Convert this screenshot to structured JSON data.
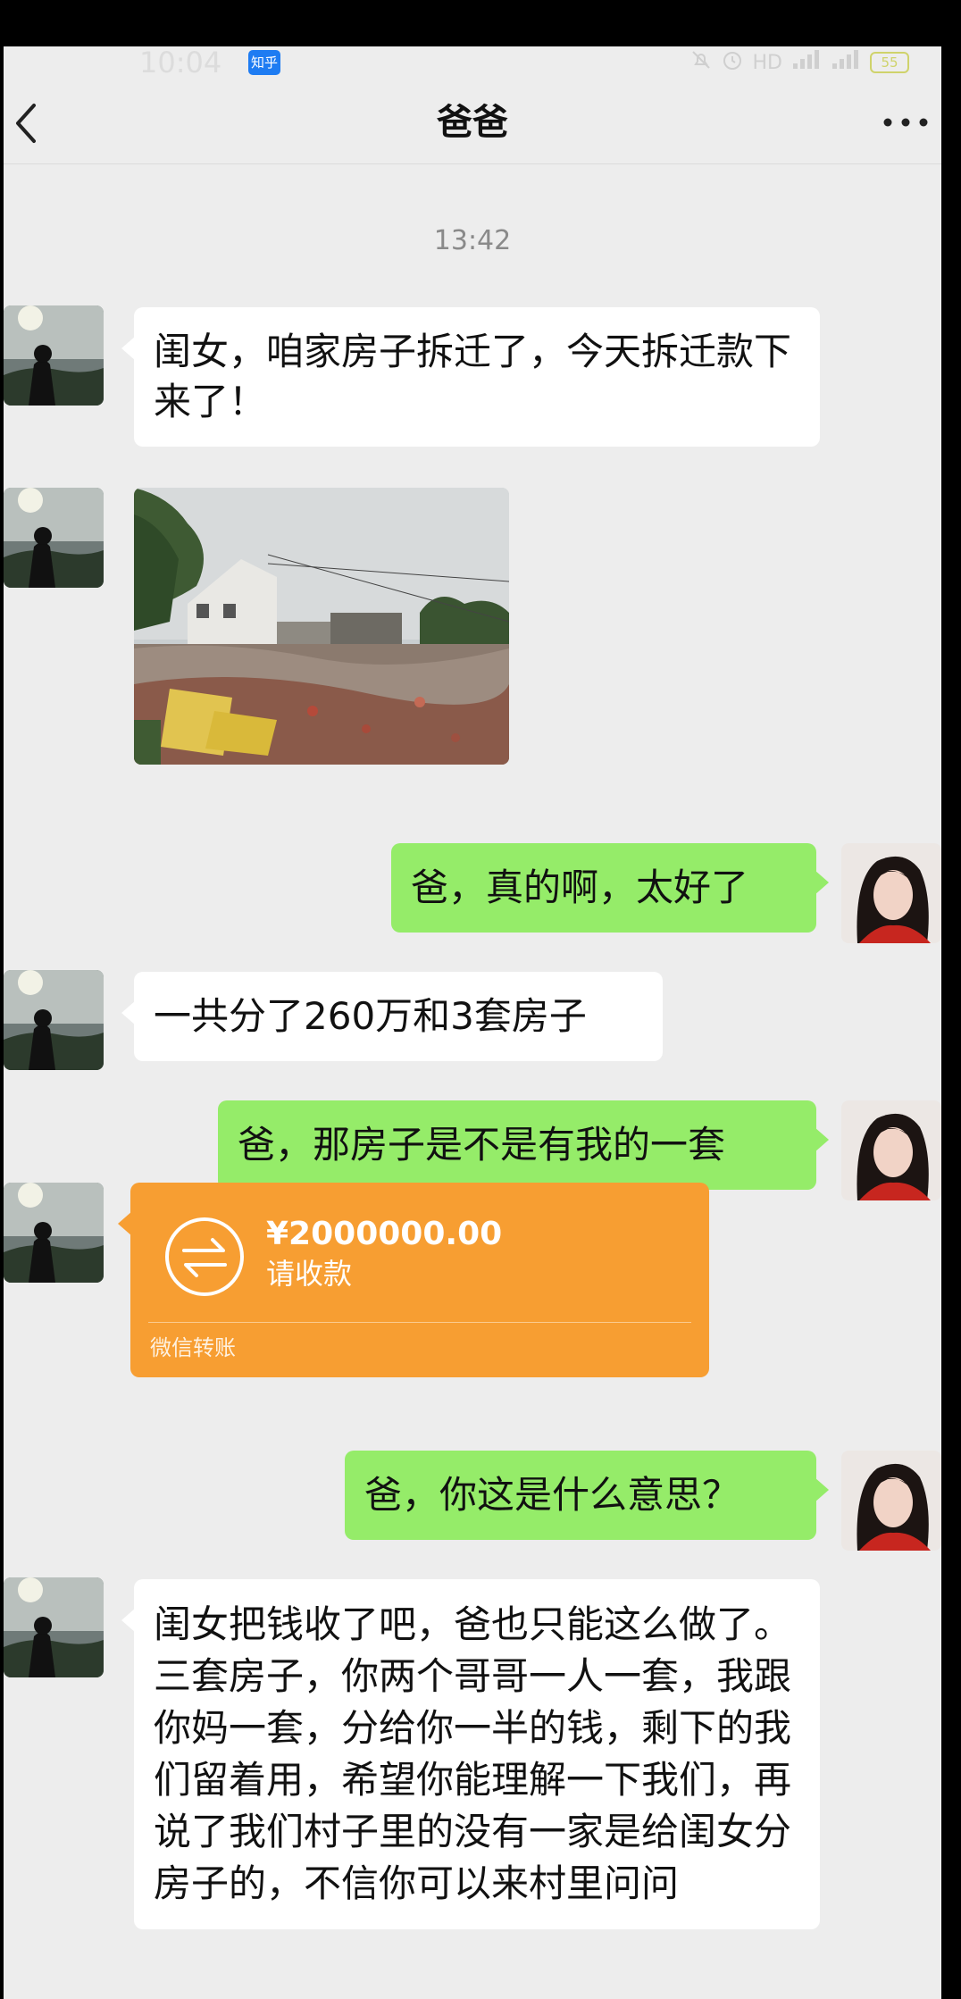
{
  "status_bar": {
    "time": "10:04",
    "app_badge": "知乎",
    "battery": "55",
    "network": "HD"
  },
  "chat": {
    "contact_name": "爸爸",
    "timestamp": "13:42"
  },
  "messages": [
    {
      "from": "dad",
      "type": "text",
      "text": "闺女，咱家房子拆迁了，今天拆迁款下来了！"
    },
    {
      "from": "dad",
      "type": "image",
      "icon": "demolished-house-photo"
    },
    {
      "from": "me",
      "type": "text",
      "text": "爸，真的啊，太好了"
    },
    {
      "from": "dad",
      "type": "text",
      "text": "一共分了260万和3套房子"
    },
    {
      "from": "me",
      "type": "text",
      "text": "爸，那房子是不是有我的一套"
    },
    {
      "from": "dad",
      "type": "transfer",
      "amount": "¥2000000.00",
      "status": "请收款",
      "footer": "微信转账"
    },
    {
      "from": "me",
      "type": "text",
      "text": "爸，你这是什么意思？"
    },
    {
      "from": "dad",
      "type": "text",
      "text": "闺女把钱收了吧，爸也只能这么做了。三套房子，你两个哥哥一人一套，我跟你妈一套，分给你一半的钱，剩下的我们留着用，希望你能理解一下我们，再说了我们村子里的没有一家是给闺女分房子的，不信你可以来村里问问"
    }
  ],
  "colors": {
    "chat_bg": "#ededed",
    "my_bubble": "#95ec69",
    "their_bubble": "#ffffff",
    "transfer_card": "#f79e32"
  }
}
